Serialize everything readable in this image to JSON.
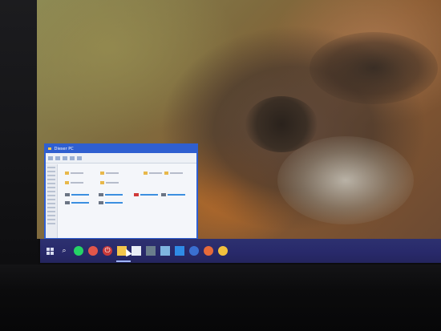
{
  "window": {
    "title": "Dieser PC"
  },
  "taskbar": {
    "icons": [
      "start-icon",
      "search-icon",
      "whatsapp-icon",
      "red-app-icon",
      "power-icon",
      "steam-icon",
      "file-explorer-icon",
      "store-icon",
      "photo-app-icon",
      "steam-icon",
      "edge-icon",
      "shield-app-icon",
      "firefox-icon",
      "chrome-icon"
    ]
  },
  "colors": {
    "taskbar": "#2d3170",
    "window_border": "#2f5fd0",
    "drive_bar": "#3c8fe0"
  }
}
